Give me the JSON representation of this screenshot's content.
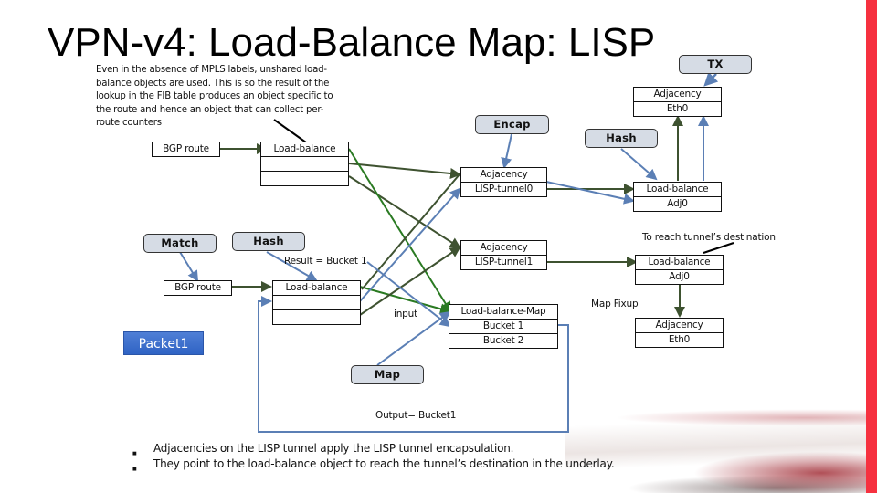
{
  "title": "VPN-v4: Load-Balance Map: LISP",
  "note": "Even in the absence of MPLS labels, unshared load-balance objects are used. This is so the result of the lookup in the FIB table produces an object specific to the route and hence an object that can collect per-route counters",
  "colors": {
    "accent_bar": "#f6313f",
    "wire_dark_green": "#3e5230",
    "wire_green": "#2a7a22",
    "wire_blue": "#5b7fb5",
    "pill_fill": "#d6dce5",
    "packet_blue": "#3a6fcf"
  },
  "nodes": {
    "bgp_route_top": "BGP route",
    "load_balance_top": [
      "Load-balance",
      "",
      ""
    ],
    "match": "Match",
    "hash_left": "Hash",
    "bgp_route_mid": "BGP route",
    "load_balance_mid": [
      "Load-balance",
      "",
      ""
    ],
    "packet": "Packet1",
    "encap": "Encap",
    "adj_lisp0": [
      "Adjacency",
      "LISP-tunnel0"
    ],
    "adj_lisp1": [
      "Adjacency",
      "LISP-tunnel1"
    ],
    "lb_map": [
      "Load-balance-Map",
      "Bucket 1",
      "Bucket 2"
    ],
    "map": "Map",
    "hash_right": "Hash",
    "tx": "TX",
    "adj_eth0_top": [
      "Adjacency",
      "Eth0"
    ],
    "lb_adj0_top": [
      "Load-balance",
      "Adj0"
    ],
    "lb_adj0_bottom": [
      "Load-balance",
      "Adj0"
    ],
    "adj_eth0_bottom": [
      "Adjacency",
      "Eth0"
    ]
  },
  "labels": {
    "result": "Result = Bucket 1",
    "input": "input",
    "output": "Output= Bucket1",
    "map_fixup": "Map Fixup",
    "reach_dest": "To reach tunnel’s destination"
  },
  "bullets": [
    "Adjacencies on the LISP tunnel apply the LISP tunnel encapsulation.",
    "They point to the load-balance object to reach the tunnel’s destination in the underlay."
  ]
}
